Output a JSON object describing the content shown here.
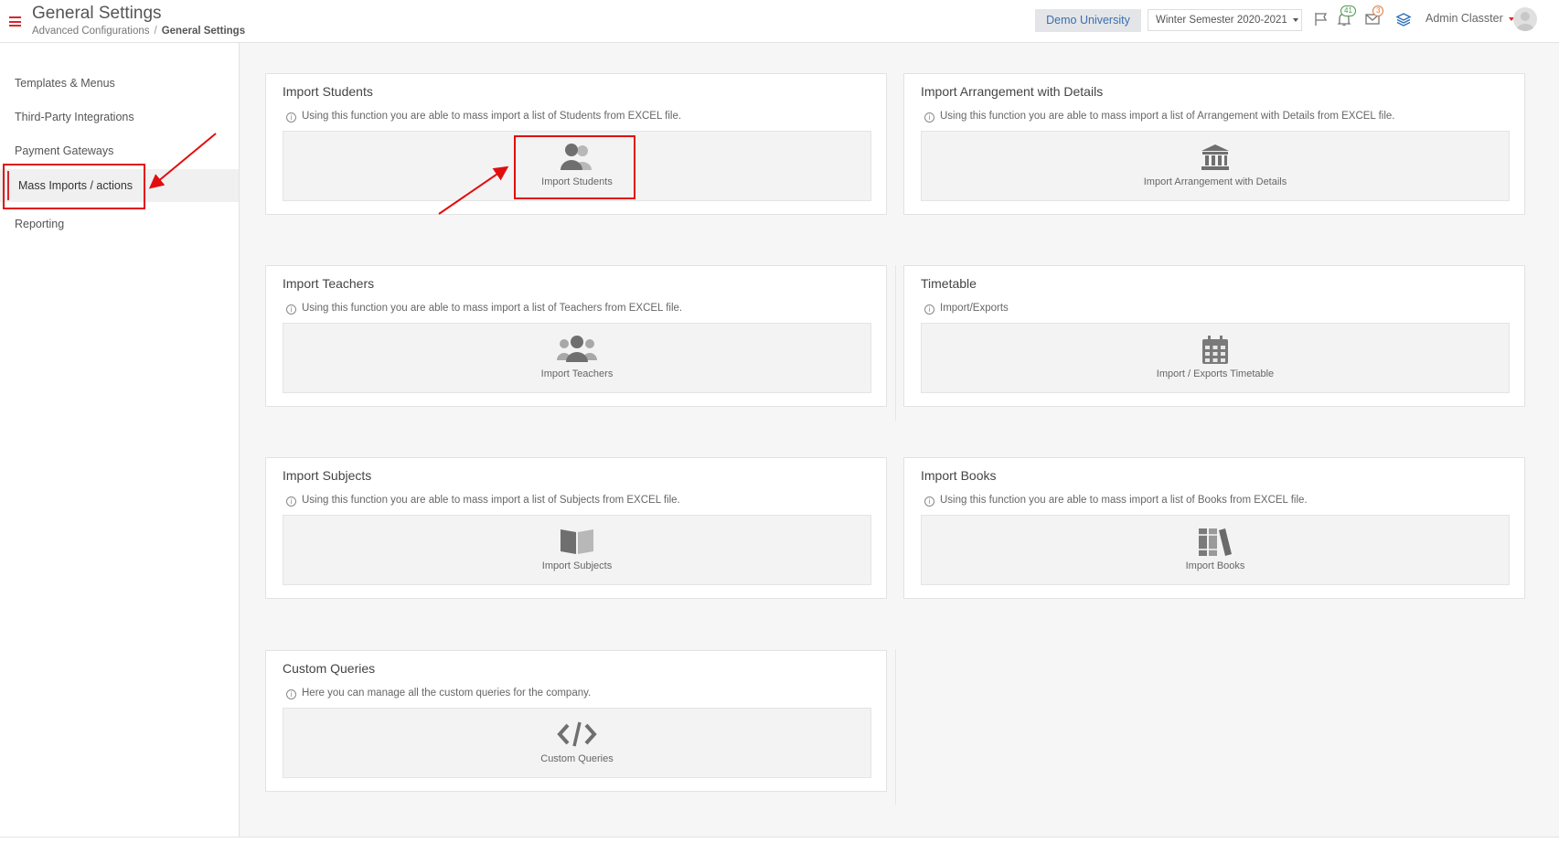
{
  "header": {
    "title": "General Settings",
    "breadcrumb": [
      "Advanced Configurations",
      "General Settings"
    ],
    "org_button": "Demo University",
    "semester": "Winter Semester 2020-2021",
    "notifications_count": "41",
    "messages_count": "3",
    "user_name": "Admin Classter",
    "colors": {
      "brand_red": "#d9262a",
      "link_blue": "#3a6fb0"
    }
  },
  "sidebar": {
    "items": [
      {
        "label": "Templates & Menus"
      },
      {
        "label": "Third-Party Integrations"
      },
      {
        "label": "Payment Gateways"
      },
      {
        "label": "Mass Imports / actions"
      },
      {
        "label": "Reporting"
      }
    ],
    "active_index": 3
  },
  "cards": {
    "import_students": {
      "title": "Import Students",
      "desc": "Using this function you are able to mass import a list of Students from EXCEL file.",
      "action": "Import Students",
      "icon": "users-icon"
    },
    "import_arrangement": {
      "title": "Import Arrangement with Details",
      "desc": "Using this function you are able to mass import a list of Arrangement with Details from EXCEL file.",
      "action": "Import Arrangement with Details",
      "icon": "institution-icon"
    },
    "import_teachers": {
      "title": "Import Teachers",
      "desc": "Using this function you are able to mass import a list of Teachers from EXCEL file.",
      "action": "Import Teachers",
      "icon": "group-icon"
    },
    "timetable": {
      "title": "Timetable",
      "desc": "Import/Exports",
      "action": "Import / Exports Timetable",
      "icon": "calendar-icon"
    },
    "import_subjects": {
      "title": "Import Subjects",
      "desc": "Using this function you are able to mass import a list of Subjects from EXCEL file.",
      "action": "Import Subjects",
      "icon": "book-open-icon"
    },
    "import_books": {
      "title": "Import Books",
      "desc": "Using this function you are able to mass import a list of Books from EXCEL file.",
      "action": "Import Books",
      "icon": "books-icon"
    },
    "custom_queries": {
      "title": "Custom Queries",
      "desc": "Here you can manage all the custom queries for the company.",
      "action": "Custom Queries",
      "icon": "code-icon"
    }
  }
}
